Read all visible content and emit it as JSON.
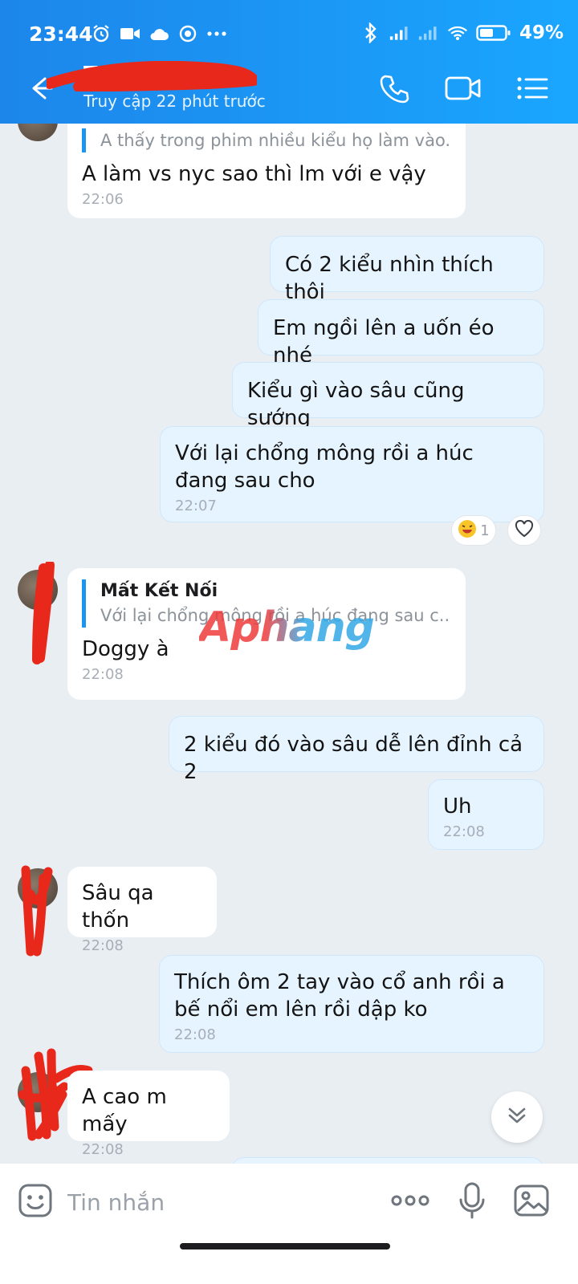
{
  "status_bar": {
    "time": "23:44",
    "battery_percent": "49%",
    "left_icons": [
      "alarm-icon",
      "video-camera-icon",
      "cloud-icon",
      "vpn-icon",
      "more-dots-icon"
    ],
    "right_icons": [
      "bluetooth-icon",
      "signal-icon",
      "signal-icon",
      "wifi-icon",
      "battery-icon"
    ]
  },
  "header": {
    "name": "T",
    "status": "Truy cập 22 phút trước",
    "actions": [
      "phone-icon",
      "video-call-icon",
      "menu-icon"
    ]
  },
  "messages": [
    {
      "side": "in",
      "quote_text": "A thấy trong phim nhiều kiểu họ làm vào...",
      "text": "A làm vs nyc sao thì lm với e vậy",
      "time": "22:06"
    },
    {
      "side": "out",
      "text": "Có 2 kiểu nhìn thích thôi"
    },
    {
      "side": "out",
      "text": "Em ngồi lên a uốn éo nhé"
    },
    {
      "side": "out",
      "text": "Kiểu gì vào sâu cũng sướng"
    },
    {
      "side": "out",
      "text": "Với lại chổng mông rồi a húc đang sau cho",
      "time": "22:07",
      "reaction_count": "1"
    },
    {
      "side": "in",
      "quote_author": "Mất Kết Nối",
      "quote_text": "Với lại chổng mông rồi a húc đang sau c...",
      "text": "Doggy à",
      "time": "22:08"
    },
    {
      "side": "out",
      "text": "2 kiểu đó vào sâu dễ lên đỉnh cả 2"
    },
    {
      "side": "out",
      "text": "Uh",
      "time": "22:08"
    },
    {
      "side": "in",
      "text": "Sâu qa thốn",
      "time": "22:08"
    },
    {
      "side": "out",
      "text": "Thích ôm 2 tay vào cổ anh rồi a bế nổi em lên rồi dập ko",
      "time": "22:08"
    },
    {
      "side": "in",
      "text": "A cao m mấy",
      "time": "22:08"
    }
  ],
  "watermark": "Aphang",
  "composer": {
    "placeholder": "Tin nhắn",
    "icons": [
      "sticker-icon",
      "more-icon",
      "microphone-icon",
      "image-icon"
    ]
  },
  "colors": {
    "header_blue": "#1c86ea",
    "outgoing_bubble": "#e6f4ff",
    "incoming_bubble": "#ffffff",
    "quote_bar": "#1a95f0",
    "redaction": "#e8281b"
  }
}
